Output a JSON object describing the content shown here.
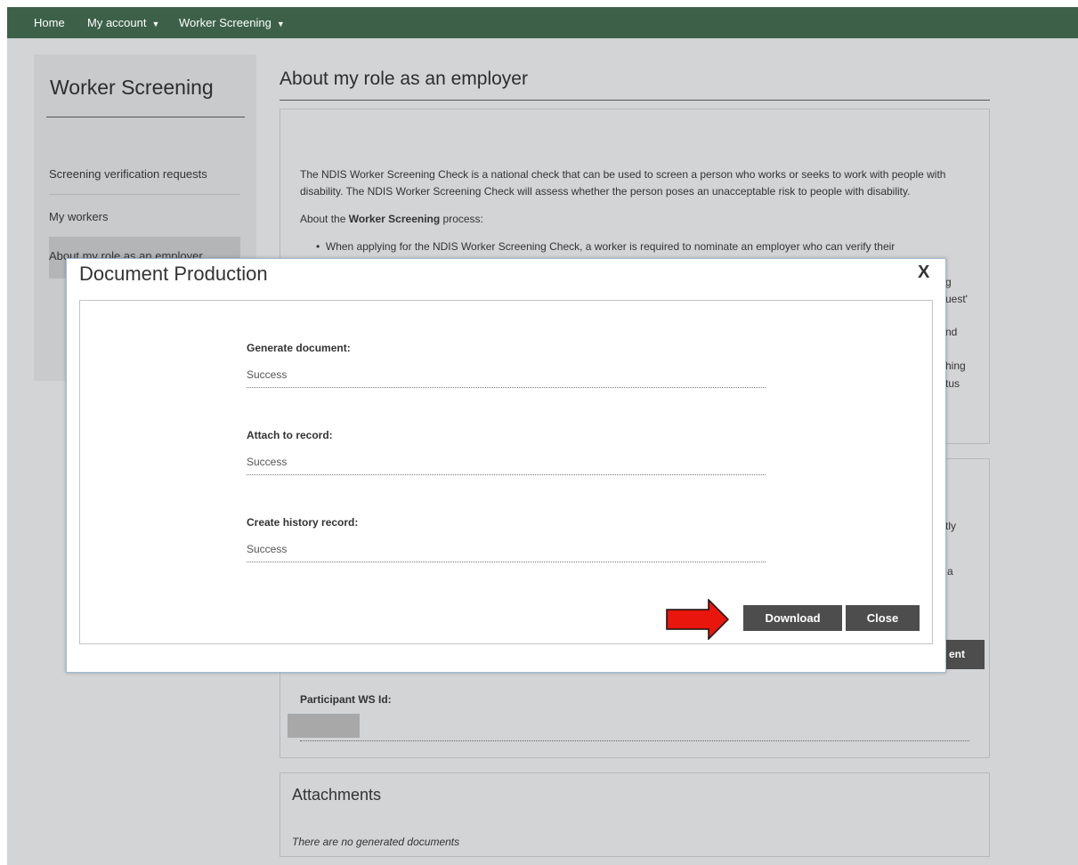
{
  "nav": {
    "home": "Home",
    "my_account": "My account",
    "worker_screening": "Worker Screening",
    "caret_icon": "caret-down-icon"
  },
  "sidebar": {
    "title": "Worker Screening",
    "items": [
      {
        "label": "Screening verification requests"
      },
      {
        "label": "My workers"
      },
      {
        "label": "About my role as an employer"
      }
    ]
  },
  "main": {
    "title": "About my role as an employer",
    "intro": "The NDIS Worker Screening Check is a national check that can be used to screen a person who works or seeks to work with people with disability. The NDIS Worker Screening Check will assess whether the person poses an unacceptable risk to people with disability.",
    "process_prefix": "About the ",
    "process_bold": "Worker Screening",
    "process_suffix": " process:",
    "bullet1": "When applying for the NDIS Worker Screening Check, a worker is required to nominate an employer who can verify their",
    "fragments": [
      "g",
      "uest'",
      "nd",
      "hing",
      "tus",
      "tly",
      "a",
      "ent"
    ],
    "participant_label": "Participant WS Id:",
    "attachments_title": "Attachments",
    "attachments_empty": "There are no generated documents"
  },
  "modal": {
    "title": "Document Production",
    "close_glyph": "X",
    "fields": [
      {
        "label": "Generate document:",
        "value": "Success"
      },
      {
        "label": "Attach to record:",
        "value": "Success"
      },
      {
        "label": "Create history record:",
        "value": "Success"
      }
    ],
    "download_label": "Download",
    "close_label": "Close",
    "arrow_icon": "red-arrow-right-icon",
    "arrow_color": "#e8160c"
  },
  "colors": {
    "nav_bg": "#3c6148",
    "button_bg": "#4d4d4d",
    "backdrop": "#d2d4d6"
  }
}
